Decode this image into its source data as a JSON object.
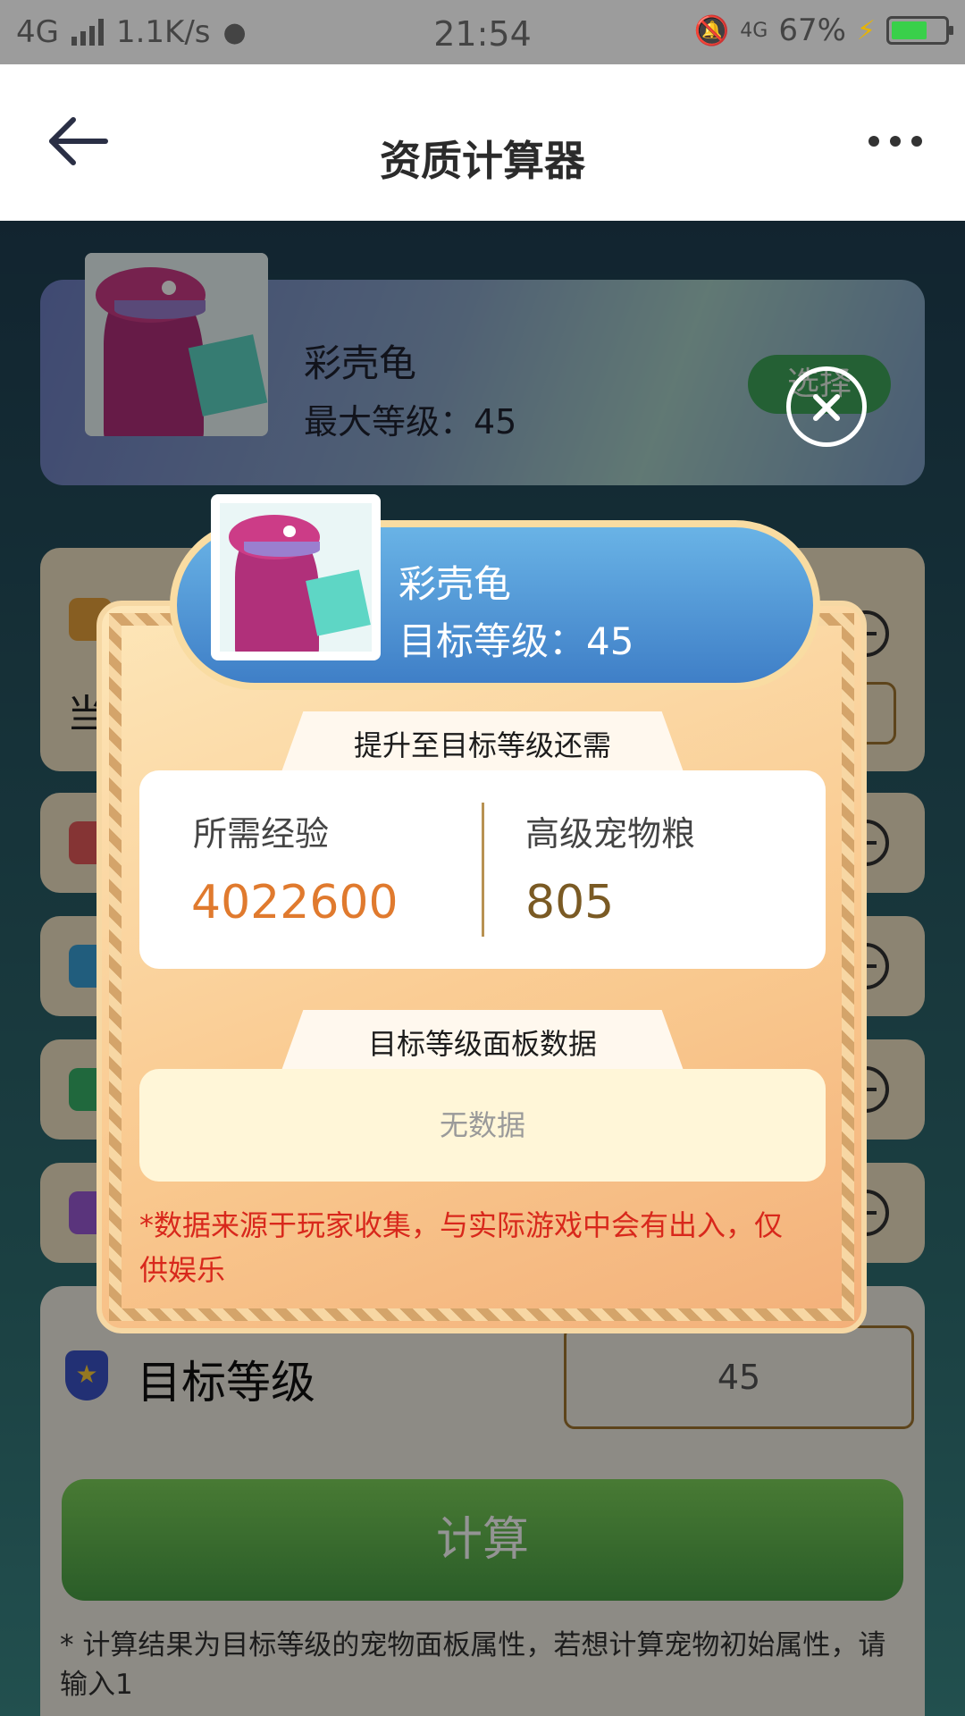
{
  "status_bar": {
    "network": "4G",
    "speed": "1.1K/s",
    "time": "21:54",
    "mobile_data": "4G",
    "battery": "67%"
  },
  "header": {
    "title": "资质计算器"
  },
  "pet_card": {
    "name": "彩壳龟",
    "max_level": "最大等级：45",
    "choose_label": "选择"
  },
  "stat_rows": {
    "first_label_fragment": "当"
  },
  "target_section": {
    "label": "目标等级",
    "value": "45",
    "calculate_label": "计算",
    "note": "* 计算结果为目标等级的宠物面板属性，若想计算宠物初始属性，请输入1"
  },
  "modal": {
    "pet_name": "彩壳龟",
    "target_level": "目标等级：45",
    "upgrade_title": "提升至目标等级还需",
    "exp_label": "所需经验",
    "exp_value": "4022600",
    "food_label": "高级宠物粮",
    "food_value": "805",
    "panel_title": "目标等级面板数据",
    "panel_empty": "无数据",
    "disclaimer": "*数据来源于玩家收集，与实际游戏中会有出入，仅供娱乐"
  },
  "colors": {
    "exp_value": "#e07a2e",
    "food_value": "#7a5a24",
    "disclaimer": "#d8281c",
    "header_pill": "#4a90d6"
  }
}
